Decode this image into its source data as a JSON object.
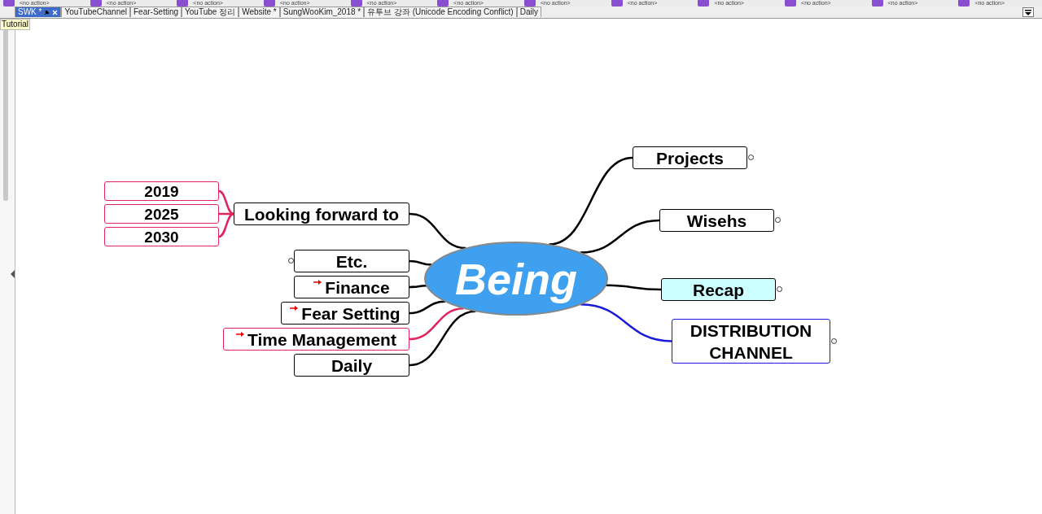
{
  "toolbar": [
    {
      "label": "<no action>"
    },
    {
      "label": "<no action>"
    },
    {
      "label": "<no action>"
    },
    {
      "label": "<no action>"
    },
    {
      "label": "<no action>"
    },
    {
      "label": "<no action>"
    },
    {
      "label": "<no action>"
    },
    {
      "label": "<no action>"
    },
    {
      "label": "<no action>"
    },
    {
      "label": "<no action>"
    },
    {
      "label": "<no action>"
    },
    {
      "label": "<no action>"
    }
  ],
  "tabs": [
    {
      "label": "SWK *",
      "selected": true
    },
    {
      "label": "YouTubeChannel",
      "selected": false
    },
    {
      "label": "Fear-Setting",
      "selected": false
    },
    {
      "label": "YouTube 정리",
      "selected": false
    },
    {
      "label": "Website *",
      "selected": false
    },
    {
      "label": "SungWooKim_2018 *",
      "selected": false
    },
    {
      "label": "유투브 강좌 (Unicode Encoding Conflict)",
      "selected": false
    },
    {
      "label": "Daily",
      "selected": false
    }
  ],
  "tooltip": "Tutorial",
  "mindmap": {
    "center": "Being",
    "left": [
      {
        "text": "Looking forward to",
        "color": "#000000",
        "link": false,
        "folded": false,
        "children": [
          {
            "text": "2019",
            "color": "#e0245e"
          },
          {
            "text": "2025",
            "color": "#e0245e"
          },
          {
            "text": "2030",
            "color": "#e0245e"
          }
        ]
      },
      {
        "text": "Etc.",
        "color": "#000000",
        "link": false,
        "folded": true
      },
      {
        "text": "Finance",
        "color": "#000000",
        "link": true,
        "folded": false
      },
      {
        "text": "Fear Setting",
        "color": "#000000",
        "link": true,
        "folded": false
      },
      {
        "text": "Time Management",
        "color": "#e0245e",
        "link": true,
        "folded": false
      },
      {
        "text": "Daily",
        "color": "#000000",
        "link": false,
        "folded": false
      }
    ],
    "right": [
      {
        "text": "Projects",
        "color": "#000000",
        "link": false,
        "folded": true,
        "highlighted": false
      },
      {
        "text": "Wisehs",
        "color": "#000000",
        "link": false,
        "folded": true,
        "highlighted": false
      },
      {
        "text": "Recap",
        "color": "#000000",
        "link": false,
        "folded": true,
        "highlighted": true
      },
      {
        "text": "DISTRIBUTION CHANNEL",
        "color": "#1a1adb",
        "link": false,
        "folded": true,
        "highlighted": false
      }
    ]
  }
}
